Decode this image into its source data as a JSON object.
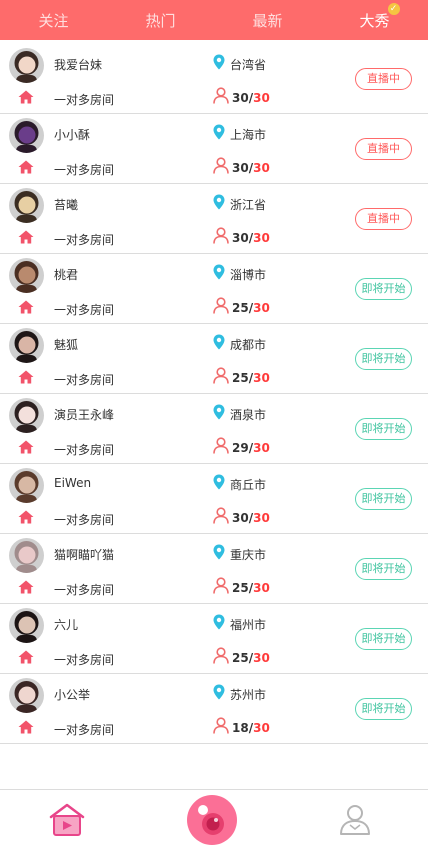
{
  "tabs": [
    {
      "label": "关注",
      "active": false
    },
    {
      "label": "热门",
      "active": false
    },
    {
      "label": "最新",
      "active": false
    },
    {
      "label": "大秀",
      "active": true
    }
  ],
  "rooms": [
    {
      "name": "我爱台妹",
      "room_type": "一对多房间",
      "city": "台湾省",
      "count": "30",
      "max": "30",
      "status": "直播中",
      "status_kind": "live",
      "avatar_colors": [
        "#f1d7c8",
        "#3a2a24"
      ]
    },
    {
      "name": "小小酥",
      "room_type": "一对多房间",
      "city": "上海市",
      "count": "30",
      "max": "30",
      "status": "直播中",
      "status_kind": "live",
      "avatar_colors": [
        "#6a3d8a",
        "#2a1a2a"
      ]
    },
    {
      "name": "苔曦",
      "room_type": "一对多房间",
      "city": "浙江省",
      "count": "30",
      "max": "30",
      "status": "直播中",
      "status_kind": "live",
      "avatar_colors": [
        "#e7cfa3",
        "#3b2d22"
      ]
    },
    {
      "name": "桃君",
      "room_type": "一对多房间",
      "city": "淄博市",
      "count": "25",
      "max": "30",
      "status": "即将开始",
      "status_kind": "soon",
      "avatar_colors": [
        "#b98a6e",
        "#4a2e22"
      ]
    },
    {
      "name": "魅狐",
      "room_type": "一对多房间",
      "city": "成都市",
      "count": "25",
      "max": "30",
      "status": "即将开始",
      "status_kind": "soon",
      "avatar_colors": [
        "#d9b5a6",
        "#1e1616"
      ]
    },
    {
      "name": "演员王永峰",
      "room_type": "一对多房间",
      "city": "酒泉市",
      "count": "29",
      "max": "30",
      "status": "即将开始",
      "status_kind": "soon",
      "avatar_colors": [
        "#f3e0dc",
        "#2c2020"
      ]
    },
    {
      "name": "EiWen",
      "room_type": "一对多房间",
      "city": "商丘市",
      "count": "30",
      "max": "30",
      "status": "即将开始",
      "status_kind": "soon",
      "avatar_colors": [
        "#d7b8a4",
        "#5a3b2c"
      ]
    },
    {
      "name": "猫啊瞄吖猫",
      "room_type": "一对多房间",
      "city": "重庆市",
      "count": "25",
      "max": "30",
      "status": "即将开始",
      "status_kind": "soon",
      "avatar_colors": [
        "#e9c9c9",
        "#a08c8c"
      ]
    },
    {
      "name": "六儿",
      "room_type": "一对多房间",
      "city": "福州市",
      "count": "25",
      "max": "30",
      "status": "即将开始",
      "status_kind": "soon",
      "avatar_colors": [
        "#dcc3b4",
        "#1c1414"
      ]
    },
    {
      "name": "小公举",
      "room_type": "一对多房间",
      "city": "苏州市",
      "count": "18",
      "max": "30",
      "status": "即将开始",
      "status_kind": "soon",
      "avatar_colors": [
        "#efd6cf",
        "#3a2624"
      ]
    }
  ],
  "bottom_nav": [
    {
      "icon": "home-tv-icon",
      "active": true
    },
    {
      "icon": "live-camera-icon",
      "active": false
    },
    {
      "icon": "profile-icon",
      "active": false
    }
  ],
  "colors": {
    "header": "#fe6b6b",
    "live": "#ff5a5a",
    "soon": "#3fc49f",
    "home_icon": "#f2536a",
    "pin_icon": "#2fbde0",
    "person_icon": "#f06a6a"
  }
}
